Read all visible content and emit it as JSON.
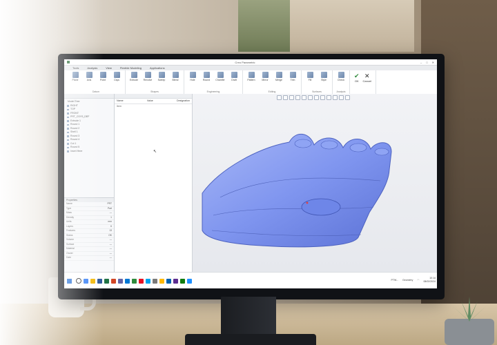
{
  "window": {
    "title": "Creo Parametric",
    "controls": [
      "–",
      "□",
      "✕"
    ]
  },
  "ribbon": {
    "tabs": [
      "Tools",
      "Analysis",
      "View",
      "Flexible Modeling",
      "Applications"
    ],
    "groups": [
      {
        "label": "Datum",
        "items": [
          "Plane",
          "Axis",
          "Point",
          "Csys"
        ]
      },
      {
        "label": "Shapes",
        "items": [
          "Extrude",
          "Revolve",
          "Sweep",
          "Blend"
        ]
      },
      {
        "label": "Engineering",
        "items": [
          "Hole",
          "Round",
          "Chamfer",
          "Draft"
        ]
      },
      {
        "label": "Editing",
        "items": [
          "Pattern",
          "Mirror",
          "Merge",
          "Trim"
        ]
      },
      {
        "label": "Surfaces",
        "items": [
          "Fill",
          "Style"
        ]
      },
      {
        "label": "Analysis",
        "items": [
          "Check"
        ]
      }
    ],
    "ok_label": "OK",
    "cancel_label": "Cancel"
  },
  "tree": {
    "items": [
      "Model Tree",
      "RIGHT",
      "TOP",
      "FRONT",
      "PRT_CSYS_DEF",
      "Extrude 1",
      "Round 1",
      "Round 2",
      "Shell 1",
      "Round 3",
      "Round 4",
      "Cut 1",
      "Round 5",
      "Insert Here"
    ],
    "props_title": "Properties",
    "props": [
      {
        "name": "Name",
        "value": "PRT"
      },
      {
        "name": "Type",
        "value": "Part"
      },
      {
        "name": "Mass",
        "value": "—"
      },
      {
        "name": "Density",
        "value": "1"
      },
      {
        "name": "Units",
        "value": "mm"
      },
      {
        "name": "Layers",
        "value": "6"
      },
      {
        "name": "Features",
        "value": "13"
      },
      {
        "name": "Status",
        "value": "OK"
      },
      {
        "name": "Volume",
        "value": "—"
      },
      {
        "name": "Surface",
        "value": "—"
      },
      {
        "name": "Material",
        "value": "—"
      },
      {
        "name": "Owner",
        "value": "—"
      },
      {
        "name": "Date",
        "value": "—"
      }
    ]
  },
  "params": {
    "columns": [
      "Name",
      "Value",
      "Designation"
    ],
    "rows": [
      "Item"
    ]
  },
  "viewport": {
    "model_color": "#7f95ef"
  },
  "taskbar": {
    "items": [
      "PTW...",
      "Geometry"
    ],
    "clock_time": "10:14",
    "clock_date": "08/02/2024"
  }
}
